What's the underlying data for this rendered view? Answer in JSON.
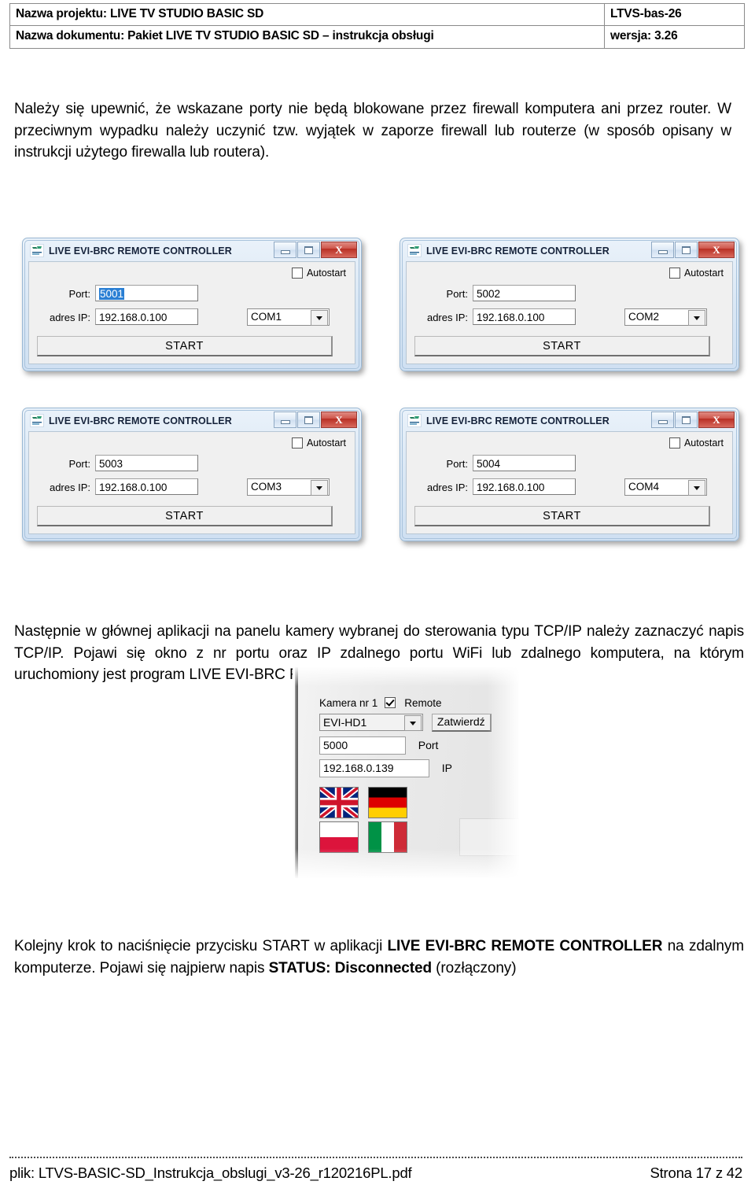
{
  "header": {
    "rows": [
      {
        "left": "Nazwa projektu: LIVE TV STUDIO BASIC SD",
        "right": "LTVS-bas-26"
      },
      {
        "left": "Nazwa dokumentu: Pakiet LIVE TV STUDIO BASIC SD – instrukcja obsługi",
        "right": "wersja:  3.26"
      }
    ]
  },
  "paragraphs": {
    "firewall": "Należy się upewnić, że wskazane porty nie będą blokowane przez firewall komputera ani przez router. W przeciwnym wypadku należy uczynić tzw. wyjątek w zaporze firewall lub routerze (w sposób opisany w instrukcji użytego firewalla lub routera).",
    "tcpip": "Następnie w głównej aplikacji na panelu kamery wybranej do sterowania typu TCP/IP należy zaznaczyć napis TCP/IP. Pojawi się okno z nr portu oraz IP zdalnego portu WiFi  lub zdalnego komputera, na którym uruchomiony jest program LIVE EVI-BRC REMOTE CONTROLLER.",
    "start_part1": "Kolejny krok to naciśnięcie przycisku START w aplikacji ",
    "start_bold1": "LIVE EVI-BRC REMOTE CONTROLLER",
    "start_part2": " na zdalnym komputerze. Pojawi się najpierw napis ",
    "start_bold2": "STATUS: Disconnected",
    "start_part3": " (rozłączony)"
  },
  "dialogs": [
    {
      "title": "LIVE EVI-BRC REMOTE CONTROLLER",
      "icon": "app-icon",
      "minimize_label": "",
      "maximize_label": "",
      "close_label": "X",
      "autostart_label": "Autostart",
      "autostart_checked": false,
      "port_label": "Port:",
      "port_value": "5001",
      "port_selected": true,
      "ip_label": "adres IP:",
      "ip_value": "192.168.0.100",
      "com_value": "COM1",
      "start_label": "START"
    },
    {
      "title": "LIVE EVI-BRC REMOTE CONTROLLER",
      "icon": "app-icon",
      "minimize_label": "",
      "maximize_label": "",
      "close_label": "X",
      "autostart_label": "Autostart",
      "autostart_checked": false,
      "port_label": "Port:",
      "port_value": "5002",
      "port_selected": false,
      "ip_label": "adres IP:",
      "ip_value": "192.168.0.100",
      "com_value": "COM2",
      "start_label": "START"
    },
    {
      "title": "LIVE EVI-BRC REMOTE CONTROLLER",
      "icon": "app-icon",
      "minimize_label": "",
      "maximize_label": "",
      "close_label": "X",
      "autostart_label": "Autostart",
      "autostart_checked": false,
      "port_label": "Port:",
      "port_value": "5003",
      "port_selected": false,
      "ip_label": "adres IP:",
      "ip_value": "192.168.0.100",
      "com_value": "COM3",
      "start_label": "START"
    },
    {
      "title": "LIVE EVI-BRC REMOTE CONTROLLER",
      "icon": "app-icon",
      "minimize_label": "",
      "maximize_label": "",
      "close_label": "X",
      "autostart_label": "Autostart",
      "autostart_checked": false,
      "port_label": "Port:",
      "port_value": "5004",
      "port_selected": false,
      "ip_label": "adres IP:",
      "ip_value": "192.168.0.100",
      "com_value": "COM4",
      "start_label": "START"
    }
  ],
  "camera_panel": {
    "camera_label": "Kamera nr 1",
    "remote_label": "Remote",
    "remote_checked": true,
    "model_value": "EVI-HD1",
    "confirm_label": "Zatwierdź",
    "port_value": "5000",
    "port_label": "Port",
    "ip_value": "192.168.0.139",
    "ip_label": "IP",
    "flags": [
      "flag-uk",
      "flag-de",
      "flag-pl",
      "flag-it"
    ]
  },
  "footer": {
    "file": "plik: LTVS-BASIC-SD_Instrukcja_obslugi_v3-26_r120216PL.pdf",
    "page": "Strona 17 z 42"
  },
  "colors": {
    "close_red": "#b82f24",
    "selection_blue": "#2a7fd4",
    "titlebar_blue": "#cfe0f2"
  }
}
